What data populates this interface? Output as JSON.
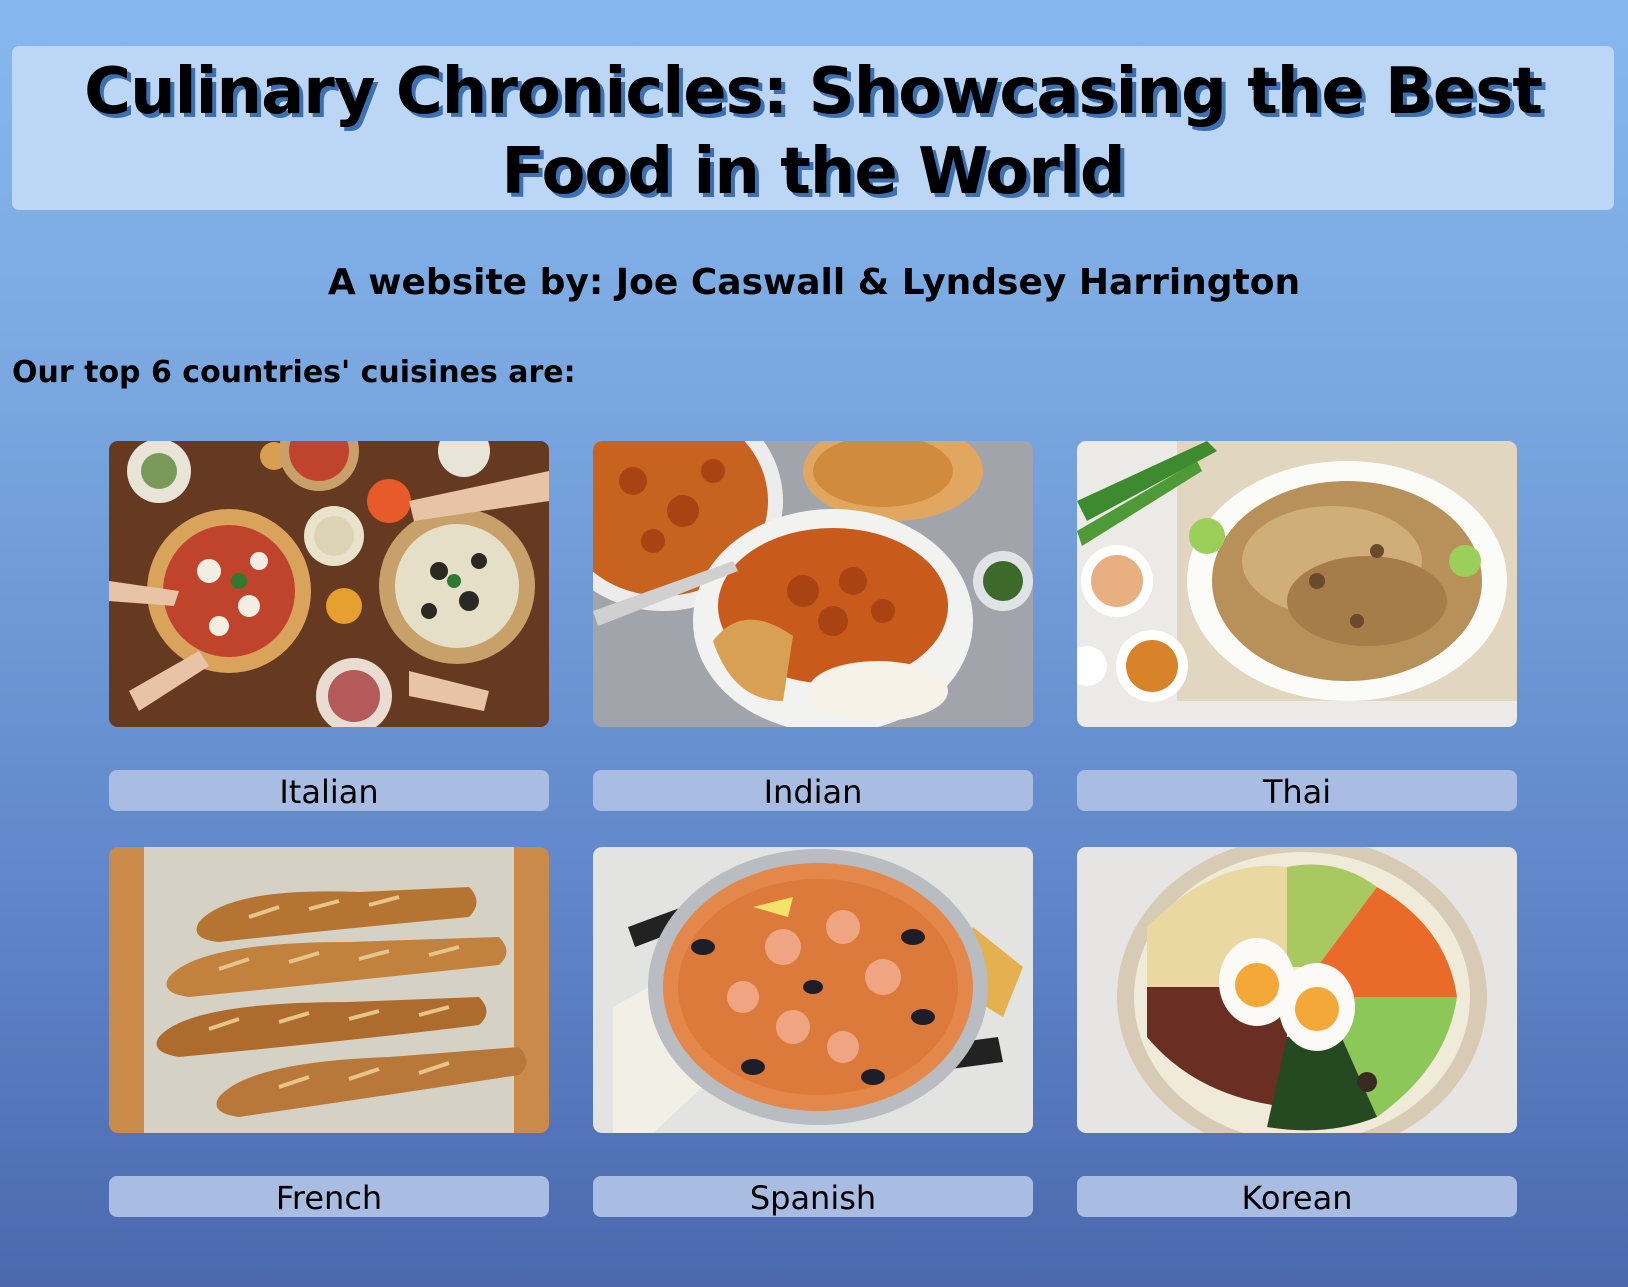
{
  "header": {
    "title": "Culinary Chronicles: Showcasing the Best Food in the World"
  },
  "byline": "A website by: Joe Caswall & Lyndsey Harrington",
  "intro": "Our top 6 countries' cuisines are:",
  "cuisines": [
    {
      "label": "Italian",
      "image": "pizza-table-photo"
    },
    {
      "label": "Indian",
      "image": "curry-rice-photo"
    },
    {
      "label": "Thai",
      "image": "pad-thai-photo"
    },
    {
      "label": "French",
      "image": "baguettes-photo"
    },
    {
      "label": "Spanish",
      "image": "paella-photo"
    },
    {
      "label": "Korean",
      "image": "bibimbap-photo"
    }
  ],
  "colors": {
    "background_top": "#86b8ef",
    "background_bottom": "#4b68ad",
    "header_box": "#bcd7f5",
    "label_box": "#a9bde2",
    "title_shadow": "#3d6fb3"
  }
}
